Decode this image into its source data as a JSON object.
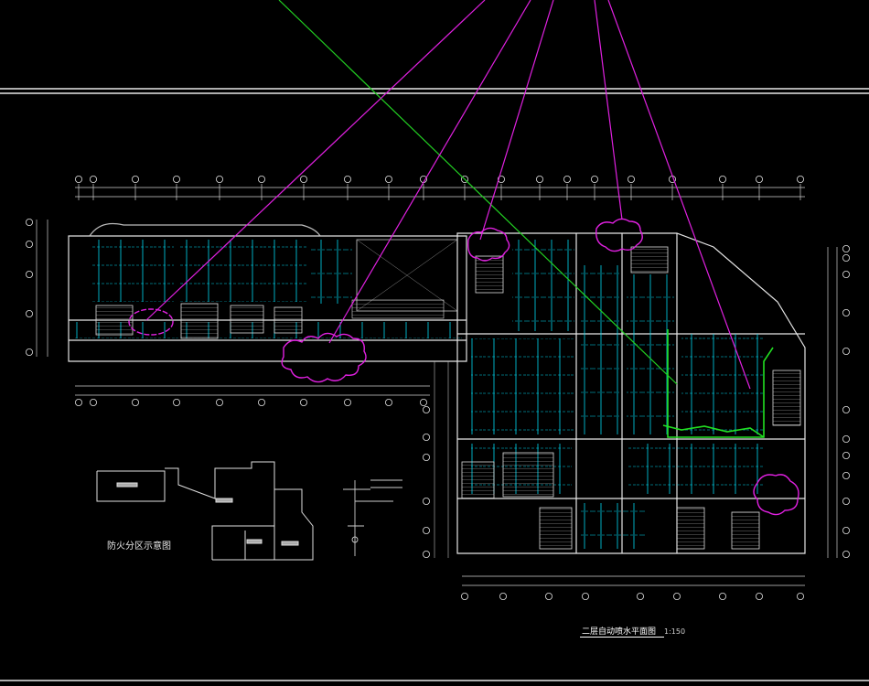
{
  "drawing": {
    "plan_title": "二层自动喷水平面图",
    "plan_scale": "1:150",
    "legend_caption": "防火分区示意图"
  },
  "colors": {
    "background": "#000000",
    "walls": "#e6e6e6",
    "sprinkler_pipes": "#00e5ff",
    "revision_clouds": "#e020e0",
    "leader_lines": "#e020e0",
    "main_pipe": "#22e022",
    "dimension_lines": "#cfcfcf"
  },
  "icons": [
    "revision-cloud-icon",
    "axis-bubble-icon",
    "sprinkler-head-icon"
  ]
}
